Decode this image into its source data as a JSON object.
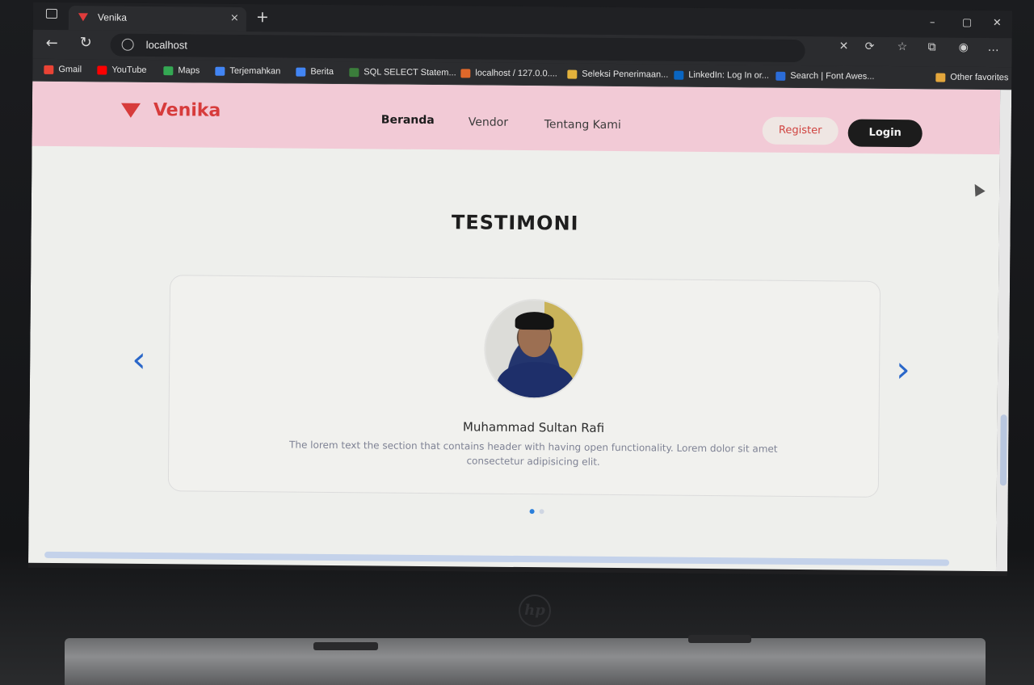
{
  "browser": {
    "tab_title": "Venika",
    "tab_close": "×",
    "new_tab": "+",
    "address": "localhost",
    "back": "←",
    "reload": "↻",
    "window_controls": [
      "–",
      "▢",
      "✕"
    ],
    "toolbar_icons": [
      "✕",
      "⟳",
      "☆",
      "⧉",
      "◉",
      "…"
    ],
    "bookmarks": [
      {
        "label": "Gmail",
        "color": "#ea4335"
      },
      {
        "label": "YouTube",
        "color": "#ff0000"
      },
      {
        "label": "Maps",
        "color": "#34a853"
      },
      {
        "label": "Terjemahkan",
        "color": "#4285f4"
      },
      {
        "label": "Berita",
        "color": "#4285f4"
      },
      {
        "label": "SQL SELECT Statem...",
        "color": "#3b7d3b"
      },
      {
        "label": "localhost / 127.0.0....",
        "color": "#e0682a"
      },
      {
        "label": "Seleksi Penerimaan...",
        "color": "#e3b23c"
      },
      {
        "label": "LinkedIn: Log In or...",
        "color": "#0a66c2"
      },
      {
        "label": "Search | Font Awes...",
        "color": "#2b6cd8"
      }
    ],
    "other_favorites": "Other favorites"
  },
  "site": {
    "brand": "Venika",
    "brand_color": "#d73b3b",
    "nav": [
      "Beranda",
      "Vendor",
      "Tentang Kami"
    ],
    "register": "Register",
    "login": "Login"
  },
  "testimonial": {
    "section_title": "TESTIMONI",
    "name": "Muhammad Sultan Rafi",
    "quote": "The lorem text the section that contains header with having open functionality. Lorem dolor sit amet consectetur adipisicing elit.",
    "prev": "‹",
    "next": "›",
    "slides": 2,
    "active_slide": 1
  },
  "laptop": {
    "logo": "hp"
  }
}
